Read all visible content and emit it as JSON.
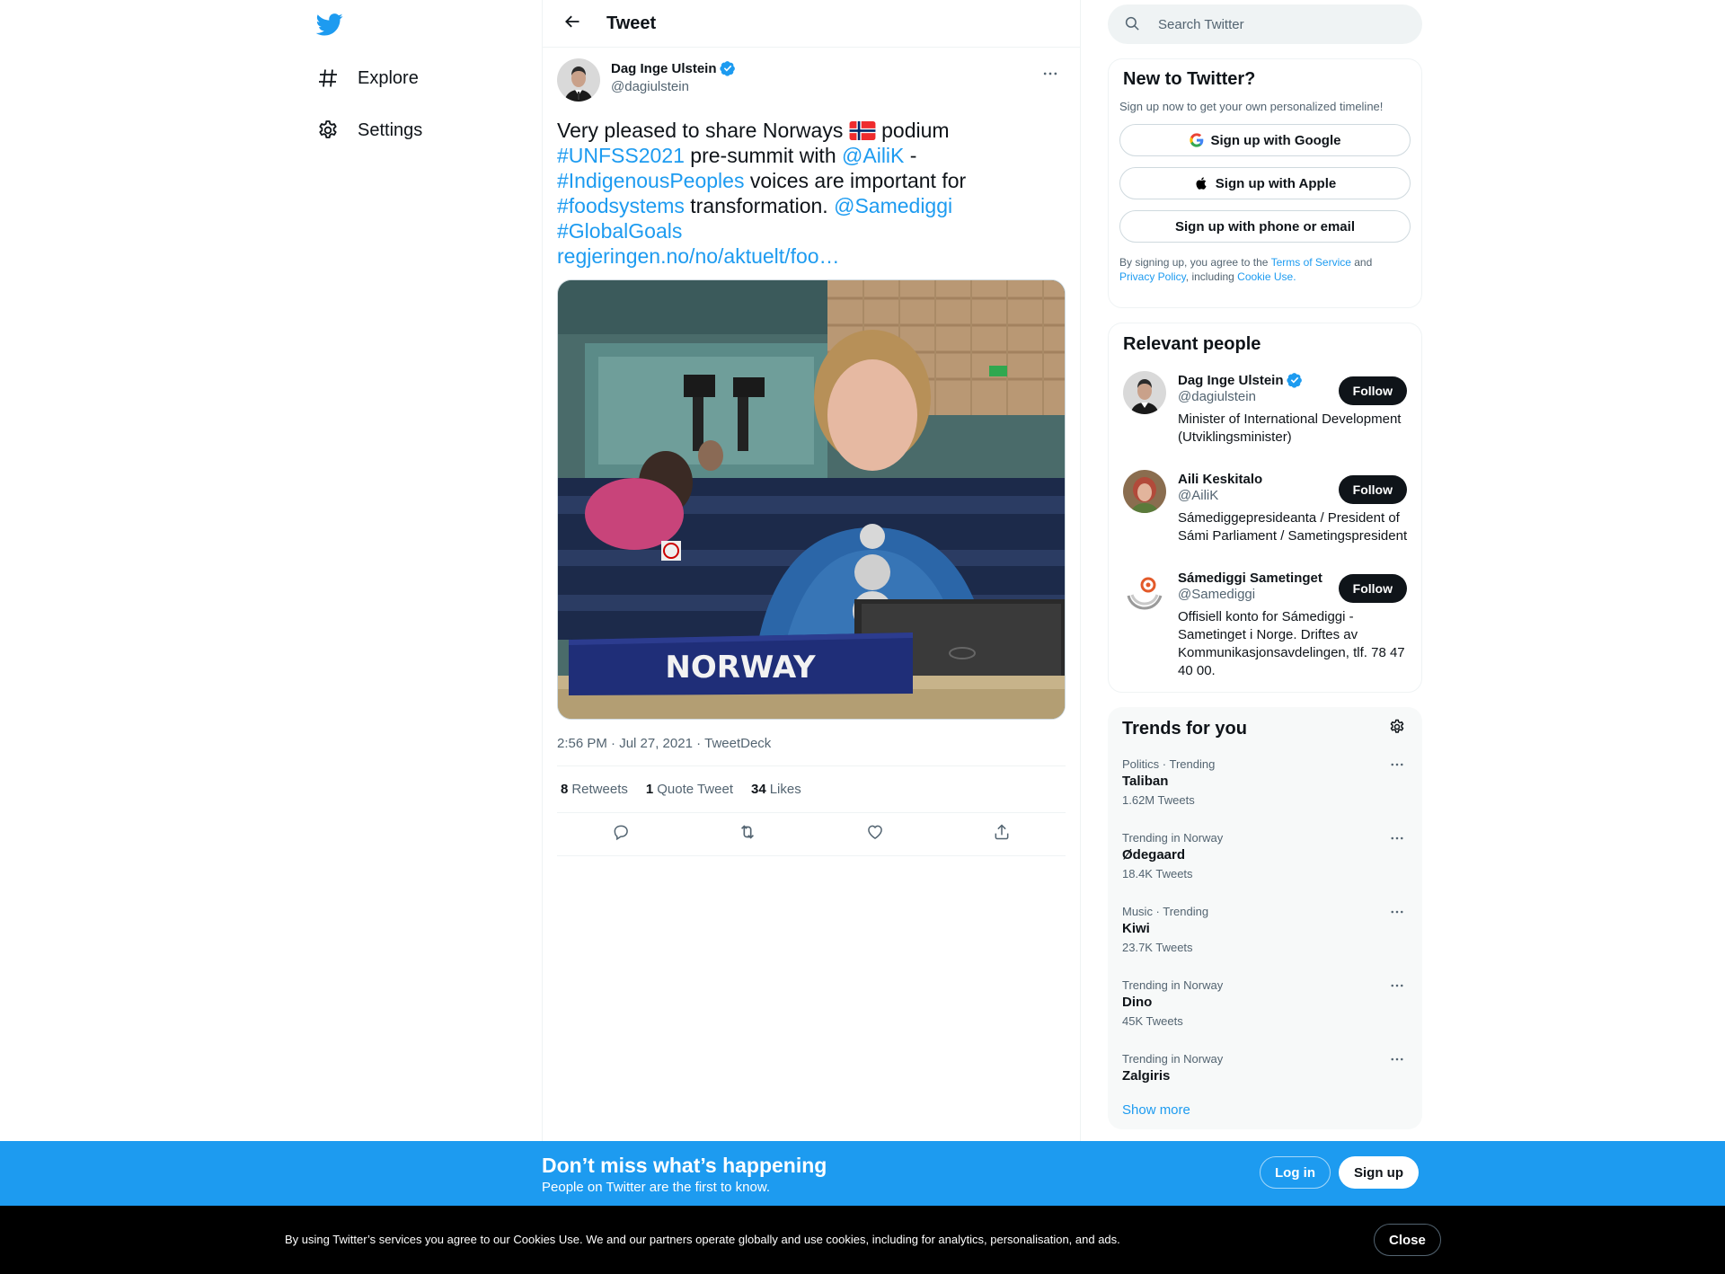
{
  "nav": {
    "logo": "twitter-bird-icon",
    "items": [
      {
        "label": "Explore",
        "icon": "hashtag-icon"
      },
      {
        "label": "Settings",
        "icon": "gear-icon"
      }
    ]
  },
  "header": {
    "title": "Tweet"
  },
  "tweet": {
    "author_name": "Dag Inge Ulstein",
    "author_handle": "@dagiulstein",
    "text_parts": {
      "p1": "Very pleased to share Norways ",
      "p2": " podium",
      "h1": "#UNFSS2021",
      "p3": " pre-summit with ",
      "m1": "@AiliK",
      "p4": " -",
      "h2": "#IndigenousPeoples",
      "p5": " voices are important for",
      "h3": "#foodsystems",
      "p6": " transformation. ",
      "m2": "@Samediggi",
      "h4": "#GlobalGoals",
      "link": "regjeringen.no/no/aktuelt/foo…"
    },
    "media_placard": "NORWAY",
    "timestamp": "2:56 PM · Jul 27, 2021",
    "source": "TweetDeck",
    "stats": {
      "retweets_count": "8",
      "retweets_label": "Retweets",
      "quotes_count": "1",
      "quotes_label": "Quote Tweet",
      "likes_count": "34",
      "likes_label": "Likes"
    }
  },
  "search": {
    "placeholder": "Search Twitter"
  },
  "new_to_twitter": {
    "title": "New to Twitter?",
    "subtitle": "Sign up now to get your own personalized timeline!",
    "google": "Sign up with Google",
    "apple": "Sign up with Apple",
    "phone": "Sign up with phone or email",
    "legal_1": "By signing up, you agree to the ",
    "tos": "Terms of Service",
    "legal_2": " and",
    "privacy": "Privacy Policy",
    "legal_3": ", including ",
    "cookie": "Cookie Use."
  },
  "relevant": {
    "title": "Relevant people",
    "follow_label": "Follow",
    "people": [
      {
        "name": "Dag Inge Ulstein",
        "handle": "@dagiulstein",
        "bio": "Minister of International Development (Utviklingsminister)",
        "verified": true
      },
      {
        "name": "Aili Keskitalo",
        "handle": "@AiliK",
        "bio": "Sámediggepresideanta / President of Sámi Parliament / Sametingspresident"
      },
      {
        "name": "Sámediggi Sametinget",
        "handle": "@Samediggi",
        "bio": "Offisiell konto for Sámediggi - Sametinget i Norge. Driftes av Kommunikasjonsavdelingen, tlf. 78 47 40 00."
      }
    ]
  },
  "trends": {
    "title": "Trends for you",
    "items": [
      {
        "meta": "Politics · Trending",
        "name": "Taliban",
        "count": "1.62M Tweets"
      },
      {
        "meta": "Trending in Norway",
        "name": "Ødegaard",
        "count": "18.4K Tweets"
      },
      {
        "meta": "Music · Trending",
        "name": "Kiwi",
        "count": "23.7K Tweets"
      },
      {
        "meta": "Trending in Norway",
        "name": "Dino",
        "count": "45K Tweets"
      },
      {
        "meta": "Trending in Norway",
        "name": "Zalgiris",
        "count": ""
      }
    ],
    "show_more": "Show more"
  },
  "signup_bar": {
    "title": "Don’t miss what’s happening",
    "subtitle": "People on Twitter are the first to know.",
    "login": "Log in",
    "signup": "Sign up"
  },
  "cookie_bar": {
    "text": "By using Twitter’s services you agree to our Cookies Use. We and our partners operate globally and use cookies, including for analytics, personalisation, and ads.",
    "close": "Close"
  },
  "colors": {
    "accent": "#1d9bf0",
    "text": "#0f1419",
    "muted": "#536471",
    "dark_button": "#0f1419"
  }
}
